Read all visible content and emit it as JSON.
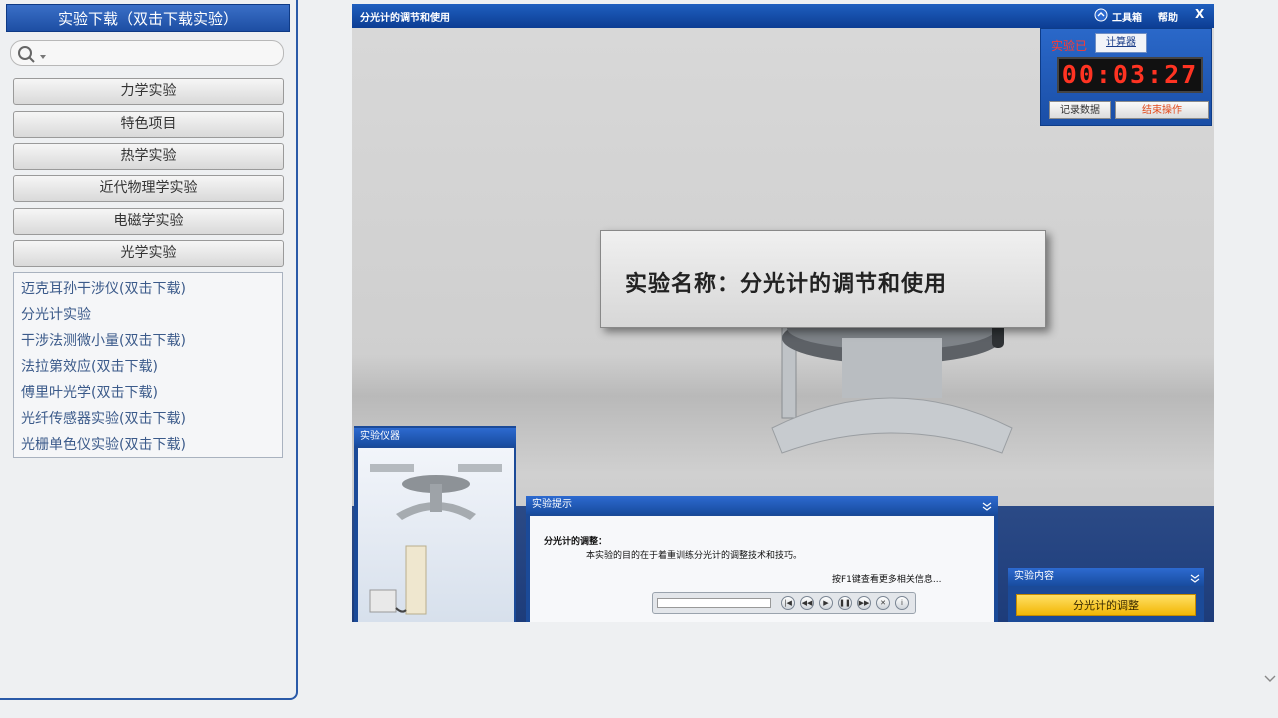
{
  "sidebar": {
    "title": "实验下载（双击下载实验）",
    "search": {
      "placeholder": ""
    },
    "categories": [
      {
        "label": "力学实验"
      },
      {
        "label": "特色项目"
      },
      {
        "label": "热学实验"
      },
      {
        "label": "近代物理学实验"
      },
      {
        "label": "电磁学实验"
      },
      {
        "label": "光学实验"
      }
    ],
    "experiments": [
      {
        "label": "迈克耳孙干涉仪(双击下载)"
      },
      {
        "label": "分光计实验"
      },
      {
        "label": "干涉法测微小量(双击下载)"
      },
      {
        "label": "法拉第效应(双击下载)"
      },
      {
        "label": "傅里叶光学(双击下载)"
      },
      {
        "label": "光纤传感器实验(双击下载)"
      },
      {
        "label": "光栅单色仪实验(双击下载)"
      }
    ]
  },
  "sim": {
    "title": "分光计的调节和使用",
    "toolbar": {
      "tools": "工具箱",
      "help": "帮助",
      "close": "X"
    },
    "experiment_name": "实验名称：分光计的调节和使用",
    "timer": {
      "label": "实验已",
      "calc_tab": "计算器",
      "time": "00:03:27",
      "record_btn": "记录数据",
      "end_btn": "结束操作"
    },
    "instruments_panel": {
      "title": "实验仪器"
    },
    "tips_panel": {
      "title": "实验提示",
      "heading": "分光计的调整：",
      "body": "本实验的目的在于着重训练分光计的调整技术和技巧。",
      "more": "按F1键查看更多相关信息..."
    },
    "content_panel": {
      "title": "实验内容",
      "item": "分光计的调整"
    }
  },
  "colors": {
    "title_blue": "#1d4ea3",
    "timer_red": "#ff3322",
    "highlight_yellow": "#f2b705"
  }
}
